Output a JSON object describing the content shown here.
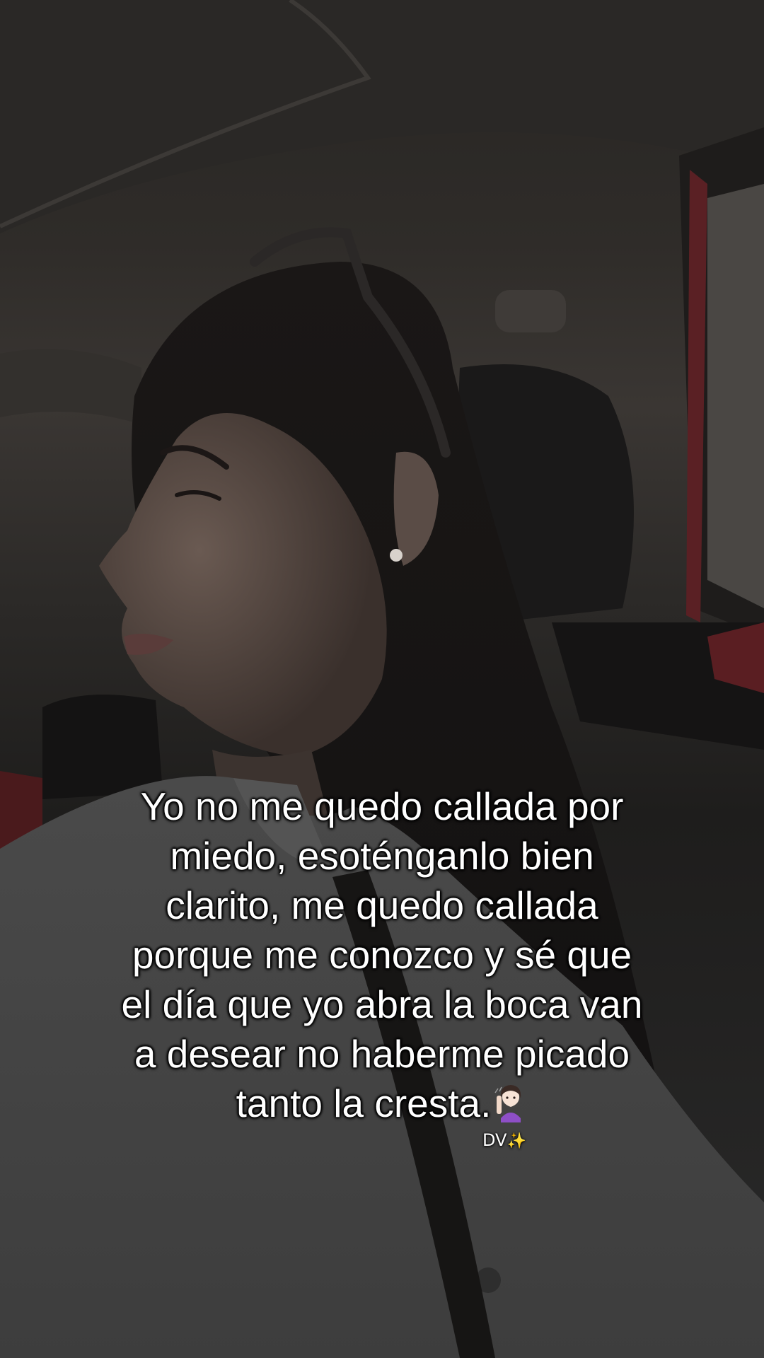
{
  "caption": {
    "lines": [
      "Yo no me quedo callada por",
      "miedo, esoténganlo bien",
      "clarito, me quedo callada",
      "porque me conozco y sé que",
      "el día que yo abra la boca van",
      "a desear no haberme picado",
      "tanto la cresta."
    ],
    "trailing_icon": "shushing-woman-emoji-icon"
  },
  "signature": {
    "text": "DV",
    "icon": "sparkles-icon",
    "icon_glyph": "✨"
  },
  "colors": {
    "caption_text": "#ffffff",
    "caption_outline": "#000000",
    "sparkles": "#ffd84a"
  }
}
